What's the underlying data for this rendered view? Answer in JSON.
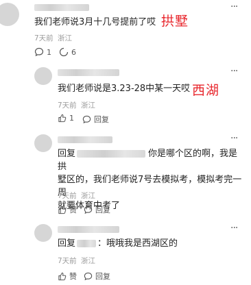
{
  "comment_main": {
    "text": "我们老师说3月十几号提前了哎",
    "time": "7天前",
    "location": "浙江",
    "reply_count": "1",
    "share_count": "6",
    "annotation": "拱墅"
  },
  "reply_1": {
    "text": "我们老师说是3.23-28中某一天哎",
    "time": "7天前",
    "location": "浙江",
    "like_count": "1",
    "reply_label": "回复",
    "annotation": "西湖"
  },
  "reply_2": {
    "prefix": "回复",
    "text_after": "你是哪个区的啊，我是拱",
    "line2": "墅区的，我们老师说7号去模拟考，模拟考完一周",
    "line3": "就要体育中考了",
    "time": "7天前",
    "location": "浙江",
    "like_label": "赞",
    "reply_label": "回复"
  },
  "reply_3": {
    "prefix": "回复",
    "text_after": "：哦哦我是西湖区的",
    "time": "7天前",
    "location": "浙江",
    "like_label": "赞",
    "reply_label": "回复"
  },
  "icons": {
    "more": "more-icon",
    "comment": "comment-icon",
    "share": "share-icon",
    "like": "like-icon"
  }
}
